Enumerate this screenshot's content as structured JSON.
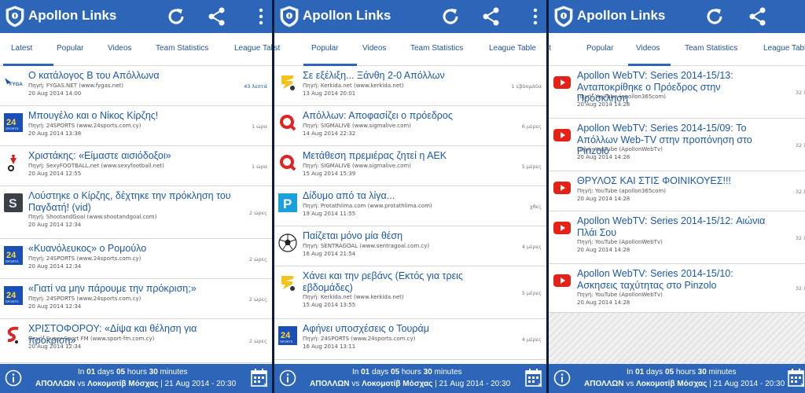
{
  "app": {
    "title": "Apollon Links"
  },
  "tabs": [
    "Latest",
    "Popular",
    "Videos",
    "Team Statistics",
    "League Table"
  ],
  "tabs_partial": {
    "s1_first": "est",
    "s2_first": "test"
  },
  "source_prefix": "Πηγή:",
  "screens": [
    {
      "active_tab": "Latest",
      "rows": [
        {
          "icon": "fygas-logo",
          "title": "Ο κατάλογος Β του Απόλλωνα",
          "source": "Πηγή: FYGAS.NET (www.fygas.net)",
          "date": "20 Aug 2014 14:00",
          "age": "43 λεπτά"
        },
        {
          "icon": "24sports-logo",
          "title": "Μπουγέλο και ο Νίκος Κίρζης!",
          "source": "Πηγή: 24SPORTS (www.24sports.com.cy)",
          "date": "20 Aug 2014 13:38",
          "age": "1 ώρα"
        },
        {
          "icon": "sexyfootball-logo",
          "title": "Χριστάκης: «Είμαστε αισιόδοξοι»",
          "source": "Πηγή: SexyFOOTBALL.net (www.sexyfootball.net)",
          "date": "20 Aug 2014 12:55",
          "age": "1 ώρα"
        },
        {
          "icon": "shootandgoal-logo",
          "title": "Λούστηκε ο Κίρζης, δέχτηκε την πρόκληση του Παγδατή! (vid)",
          "source": "Πηγή: ShootandGoal (www.shootandgoal.com)",
          "date": "20 Aug 2014 12:34",
          "age": "2 ώρες"
        },
        {
          "icon": "24sports-logo",
          "title": "«Κυανόλευκος» ο Ρομούλο",
          "source": "Πηγή: 24SPORTS (www.24sports.com.cy)",
          "date": "20 Aug 2014 12:34",
          "age": "2 ώρες"
        },
        {
          "icon": "24sports-logo",
          "title": "«Γιατί να μην πάρουμε την πρόκριση;»",
          "source": "Πηγή: 24SPORTS (www.24sports.com.cy)",
          "date": "20 Aug 2014 12:34",
          "age": "2 ώρες"
        },
        {
          "icon": "supersport-logo",
          "title": "ΧΡΙΣΤΟΦΟΡΟΥ: «Δίψα και θέληση για πρόκριση»",
          "source": "Πηγή: Super Sport FM (www.sport-fm.com.cy)",
          "date": "20 Aug 2014 12:34",
          "age": "2 ώρες"
        }
      ]
    },
    {
      "active_tab": "Popular",
      "rows": [
        {
          "icon": "kerkida-logo",
          "title": "Σε εξέλιξη... Ξάνθη 2-0 Απόλλων",
          "source": "Πηγή: Kerkida.net (www.kerkida.net)",
          "date": "13 Aug 2014 20:01",
          "age": "1 εβδομάδα"
        },
        {
          "icon": "sigmalive-logo",
          "title": "Απόλλων: Αποφασίζει ο πρόεδρος",
          "source": "Πηγή: SIGMALIVE (www.sigmalive.com)",
          "date": "14 Aug 2014 22:32",
          "age": "6 μέρες"
        },
        {
          "icon": "sigmalive-logo",
          "title": "Μετάθεση πρεμιέρας ζητεί η ΑΕΚ",
          "source": "Πηγή: SIGMALIVE (www.sigmalive.com)",
          "date": "15 Aug 2014 15:39",
          "age": "5 μέρες"
        },
        {
          "icon": "protathlima-logo",
          "title": "Δίδυμο από τα λίγα...",
          "source": "Πηγή: Protathlima.com (www.protathlima.com)",
          "date": "19 Aug 2014 11:55",
          "age": "χθες"
        },
        {
          "icon": "football-icon",
          "title": "Παίζεται μόνο μία θέση",
          "source": "Πηγή: SENTRAGOAL (www.sentragoal.com.cy)",
          "date": "16 Aug 2014 21:54",
          "age": "4 μέρες"
        },
        {
          "icon": "kerkida-logo",
          "title": "Χάνει και την ρεβάνς (Εκτός για τρεις εβδομάδες)",
          "source": "Πηγή: Kerkida.net (www.kerkida.net)",
          "date": "15 Aug 2014 13:55",
          "age": "5 μέρες"
        },
        {
          "icon": "24sports-logo",
          "title": "Αφήνει υποσχέσεις ο Τουράμ",
          "source": "Πηγή: 24SPORTS (www.24sports.com.cy)",
          "date": "16 Aug 2014 13:11",
          "age": "4 μέρες"
        }
      ]
    },
    {
      "active_tab": "Videos",
      "rows": [
        {
          "icon": "youtube-icon",
          "title": "Apollon WebTV: Series 2014-15/13: Ανταποκρίθηκε ο Πρόεδρος στην Πρόσκληση",
          "source": "Πηγή: YouTube (apollon365com)",
          "date": "20 Aug 2014 14:28",
          "age": "32 λ"
        },
        {
          "icon": "youtube-icon",
          "title": "Apollon WebTV: Series 2014-15/09: Το Απόλλων Web-TV στην προπόνηση στο Pinzolo",
          "source": "Πηγή: YouTube (ApollonWebTv)",
          "date": "20 Aug 2014 14:28",
          "age": "32 λ"
        },
        {
          "icon": "youtube-icon",
          "title": "ΘΡΥΛΟΣ ΚΑΙ ΣΤΙΣ ΦΟΙΝΙΚΟΥΕΣ!!!",
          "source": "Πηγή: YouTube (apollon365com)",
          "date": "20 Aug 2014 14:28",
          "age": "32 λ"
        },
        {
          "icon": "youtube-icon",
          "title": "Apollon WebTV: Series 2014-15/12: Αιώνια Πλάι Σου",
          "source": "Πηγή: YouTube (ApollonWebTv)",
          "date": "20 Aug 2014 14:28",
          "age": "32 λ"
        },
        {
          "icon": "youtube-icon",
          "title": "Apollon WebTV: Series 2014-15/10: Ασκησεις ταχύτητας στο Pinzolo",
          "source": "Πηγή: YouTube (ApollonWebTv)",
          "date": "20 Aug 2014 14:28",
          "age": "32 λ"
        }
      ]
    }
  ],
  "countdown": {
    "in": "In",
    "days": "01",
    "days_label": "days",
    "hours": "05",
    "hours_label": "hours",
    "minutes": "30",
    "minutes_label": "minutes",
    "home": "ΑΠΟΛΛΩΝ",
    "vs": "vs",
    "away": "Λοκομοτίβ Μόσχας",
    "datetime": "| 21 Aug 2014 - 20:30"
  },
  "colors": {
    "primary": "#2d66b8",
    "link": "#1d58a8",
    "separator": "#0c1d3b"
  }
}
